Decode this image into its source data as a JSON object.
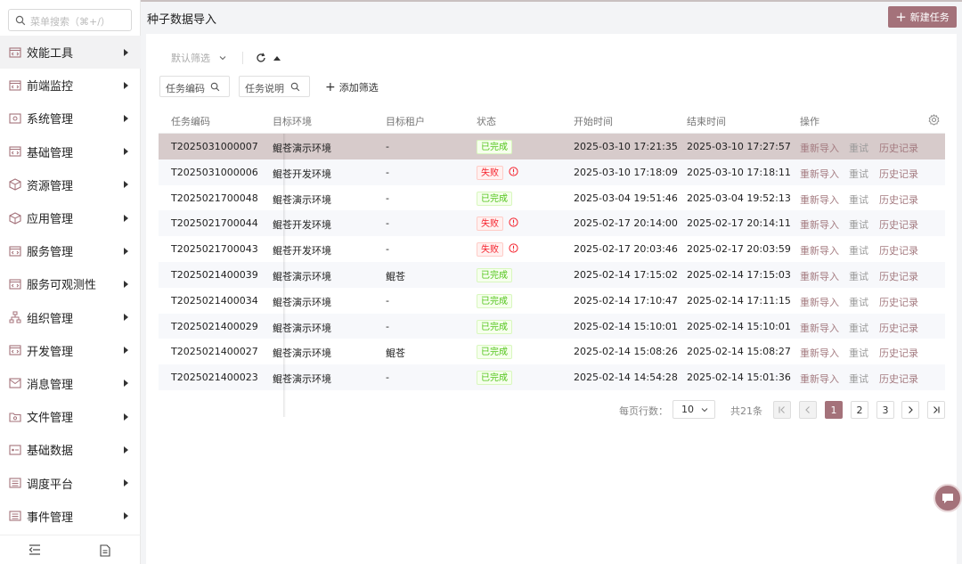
{
  "search": {
    "placeholder": "菜单搜索（⌘+/）"
  },
  "sidebar": {
    "items": [
      {
        "label": "效能工具",
        "icon": "code-window-icon"
      },
      {
        "label": "前端监控",
        "icon": "code-window-icon"
      },
      {
        "label": "系统管理",
        "icon": "settings-window-icon"
      },
      {
        "label": "基础管理",
        "icon": "code-window-icon"
      },
      {
        "label": "资源管理",
        "icon": "cube-icon"
      },
      {
        "label": "应用管理",
        "icon": "cube-icon"
      },
      {
        "label": "服务管理",
        "icon": "code-window-icon"
      },
      {
        "label": "服务可观测性",
        "icon": "code-window-icon"
      },
      {
        "label": "组织管理",
        "icon": "org-tree-icon"
      },
      {
        "label": "开发管理",
        "icon": "code-window-icon"
      },
      {
        "label": "消息管理",
        "icon": "message-icon"
      },
      {
        "label": "文件管理",
        "icon": "folder-icon"
      },
      {
        "label": "基础数据",
        "icon": "database-icon"
      },
      {
        "label": "调度平台",
        "icon": "list-icon"
      },
      {
        "label": "事件管理",
        "icon": "list-icon"
      }
    ],
    "footer_icons": [
      "collapse-menu-icon",
      "document-icon"
    ]
  },
  "header": {
    "title": "种子数据导入",
    "new_task_label": "新建任务"
  },
  "filters": {
    "default_filter": "默认筛选",
    "task_code_label": "任务编码",
    "task_desc_label": "任务说明",
    "add_filter_label": "添加筛选"
  },
  "table": {
    "columns": [
      "任务编码",
      "目标环境",
      "目标租户",
      "状态",
      "开始时间",
      "结束时间",
      "操作"
    ],
    "actions": {
      "reimport": "重新导入",
      "retry": "重试",
      "history": "历史记录"
    },
    "rows": [
      {
        "code": "T2025031000007",
        "env": "鲲苍演示环境",
        "tenant": "-",
        "status": "已完成",
        "status_type": "ok",
        "start": "2025-03-10 17:21:35",
        "end": "2025-03-10 17:27:57"
      },
      {
        "code": "T2025031000006",
        "env": "鲲苍开发环境",
        "tenant": "-",
        "status": "失败",
        "status_type": "fail",
        "start": "2025-03-10 17:18:09",
        "end": "2025-03-10 17:18:11"
      },
      {
        "code": "T2025021700048",
        "env": "鲲苍演示环境",
        "tenant": "-",
        "status": "已完成",
        "status_type": "ok",
        "start": "2025-03-04 19:51:46",
        "end": "2025-03-04 19:52:13"
      },
      {
        "code": "T2025021700044",
        "env": "鲲苍开发环境",
        "tenant": "-",
        "status": "失败",
        "status_type": "fail",
        "start": "2025-02-17 20:14:00",
        "end": "2025-02-17 20:14:11"
      },
      {
        "code": "T2025021700043",
        "env": "鲲苍开发环境",
        "tenant": "-",
        "status": "失败",
        "status_type": "fail",
        "start": "2025-02-17 20:03:46",
        "end": "2025-02-17 20:03:59"
      },
      {
        "code": "T2025021400039",
        "env": "鲲苍演示环境",
        "tenant": "鲲苍",
        "status": "已完成",
        "status_type": "ok",
        "start": "2025-02-14 17:15:02",
        "end": "2025-02-14 17:15:03"
      },
      {
        "code": "T2025021400034",
        "env": "鲲苍演示环境",
        "tenant": "-",
        "status": "已完成",
        "status_type": "ok",
        "start": "2025-02-14 17:10:47",
        "end": "2025-02-14 17:11:15"
      },
      {
        "code": "T2025021400029",
        "env": "鲲苍演示环境",
        "tenant": "-",
        "status": "已完成",
        "status_type": "ok",
        "start": "2025-02-14 15:10:01",
        "end": "2025-02-14 15:10:01"
      },
      {
        "code": "T2025021400027",
        "env": "鲲苍演示环境",
        "tenant": "鲲苍",
        "status": "已完成",
        "status_type": "ok",
        "start": "2025-02-14 15:08:26",
        "end": "2025-02-14 15:08:27"
      },
      {
        "code": "T2025021400023",
        "env": "鲲苍演示环境",
        "tenant": "-",
        "status": "已完成",
        "status_type": "ok",
        "start": "2025-02-14 14:54:28",
        "end": "2025-02-14 15:01:36"
      }
    ]
  },
  "pagination": {
    "page_size_label": "每页行数：",
    "page_size": "10",
    "total": "共21条",
    "pages": [
      "1",
      "2",
      "3"
    ],
    "current_page": "1"
  },
  "colors": {
    "accent": "#a4727a",
    "selected_row": "#d7cbcb",
    "success": "#52c41a",
    "error": "#f5222d"
  }
}
